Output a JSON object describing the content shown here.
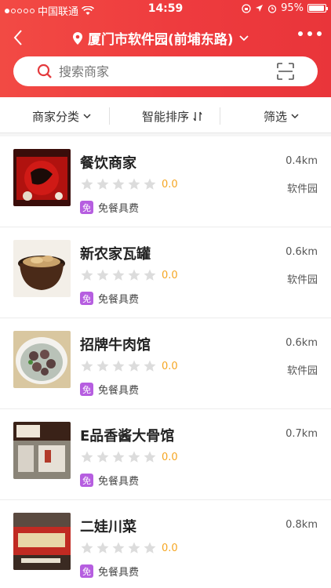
{
  "status_bar": {
    "carrier": "中国联通",
    "time": "14:59",
    "battery": "95%",
    "battery_level": 0.95,
    "signal_bars_filled": 1,
    "signal_bars_total": 5
  },
  "nav": {
    "location": "厦门市软件园(前埔东路)"
  },
  "search": {
    "placeholder": "搜索商家"
  },
  "filters": [
    {
      "label": "商家分类"
    },
    {
      "label": "智能排序"
    },
    {
      "label": "筛选"
    }
  ],
  "merchants": [
    {
      "name": "餐饮商家",
      "rating": "0.0",
      "badge": "免",
      "tag": "免餐具费",
      "distance": "0.4km",
      "area": "软件园"
    },
    {
      "name": "新农家瓦罐",
      "rating": "0.0",
      "badge": "免",
      "tag": "免餐具费",
      "distance": "0.6km",
      "area": "软件园"
    },
    {
      "name": "招牌牛肉馆",
      "rating": "0.0",
      "badge": "免",
      "tag": "免餐具费",
      "distance": "0.6km",
      "area": "软件园"
    },
    {
      "name": "E品香酱大骨馆",
      "rating": "0.0",
      "badge": "免",
      "tag": "免餐具费",
      "distance": "0.7km",
      "area": ""
    },
    {
      "name": "二娃川菜",
      "rating": "0.0",
      "badge": "免",
      "tag": "免餐具费",
      "distance": "0.8km",
      "area": ""
    }
  ],
  "colors": {
    "brand": "#ee3b3e",
    "badge": "#b65ee0",
    "rating": "#f5a623"
  },
  "icons": [
    "back-icon",
    "location-pin-icon",
    "chevron-down-icon",
    "more-icon",
    "search-icon",
    "scan-icon",
    "sort-icon",
    "star-icon",
    "wifi-icon"
  ]
}
